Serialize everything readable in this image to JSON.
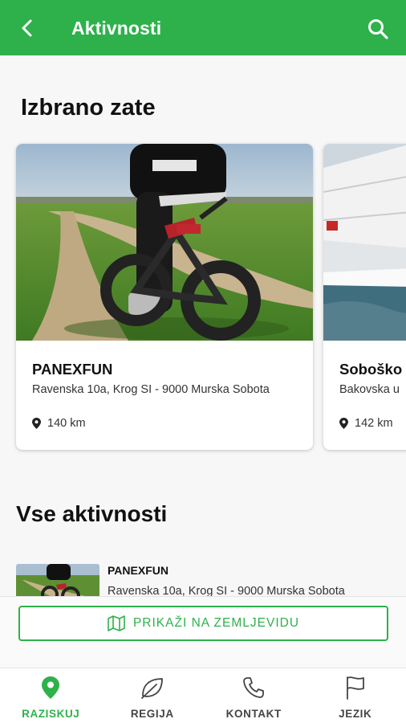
{
  "app_bar": {
    "title": "Aktivnosti",
    "back_icon": "arrow-back-icon",
    "search_icon": "search-icon",
    "color": "#2eb14b"
  },
  "featured": {
    "title": "Izbrano zate",
    "cards": [
      {
        "name": "PANEXFUN",
        "address": "Ravenska 10a, Krog SI - 9000 Murska Sobota",
        "distance": "140 km",
        "image": "fat-tire e-bike on rural dirt road"
      },
      {
        "name": "Soboško",
        "address": "Bakovska u",
        "distance": "142 km",
        "image": "sailboat sail on water"
      }
    ]
  },
  "all_activities": {
    "title": "Vse aktivnosti",
    "items": [
      {
        "name": "PANEXFUN",
        "address": "Ravenska 10a, Krog SI - 9000 Murska Sobota"
      }
    ]
  },
  "map_button": {
    "label": "PRIKAŽI NA ZEMLJEVIDU",
    "icon": "map-icon"
  },
  "bottom_nav": {
    "items": [
      {
        "label": "RAZISKUJ",
        "icon": "location-pin-icon",
        "active": true
      },
      {
        "label": "REGIJA",
        "icon": "leaf-icon",
        "active": false
      },
      {
        "label": "KONTAKT",
        "icon": "phone-icon",
        "active": false
      },
      {
        "label": "JEZIK",
        "icon": "flag-icon",
        "active": false
      }
    ]
  }
}
